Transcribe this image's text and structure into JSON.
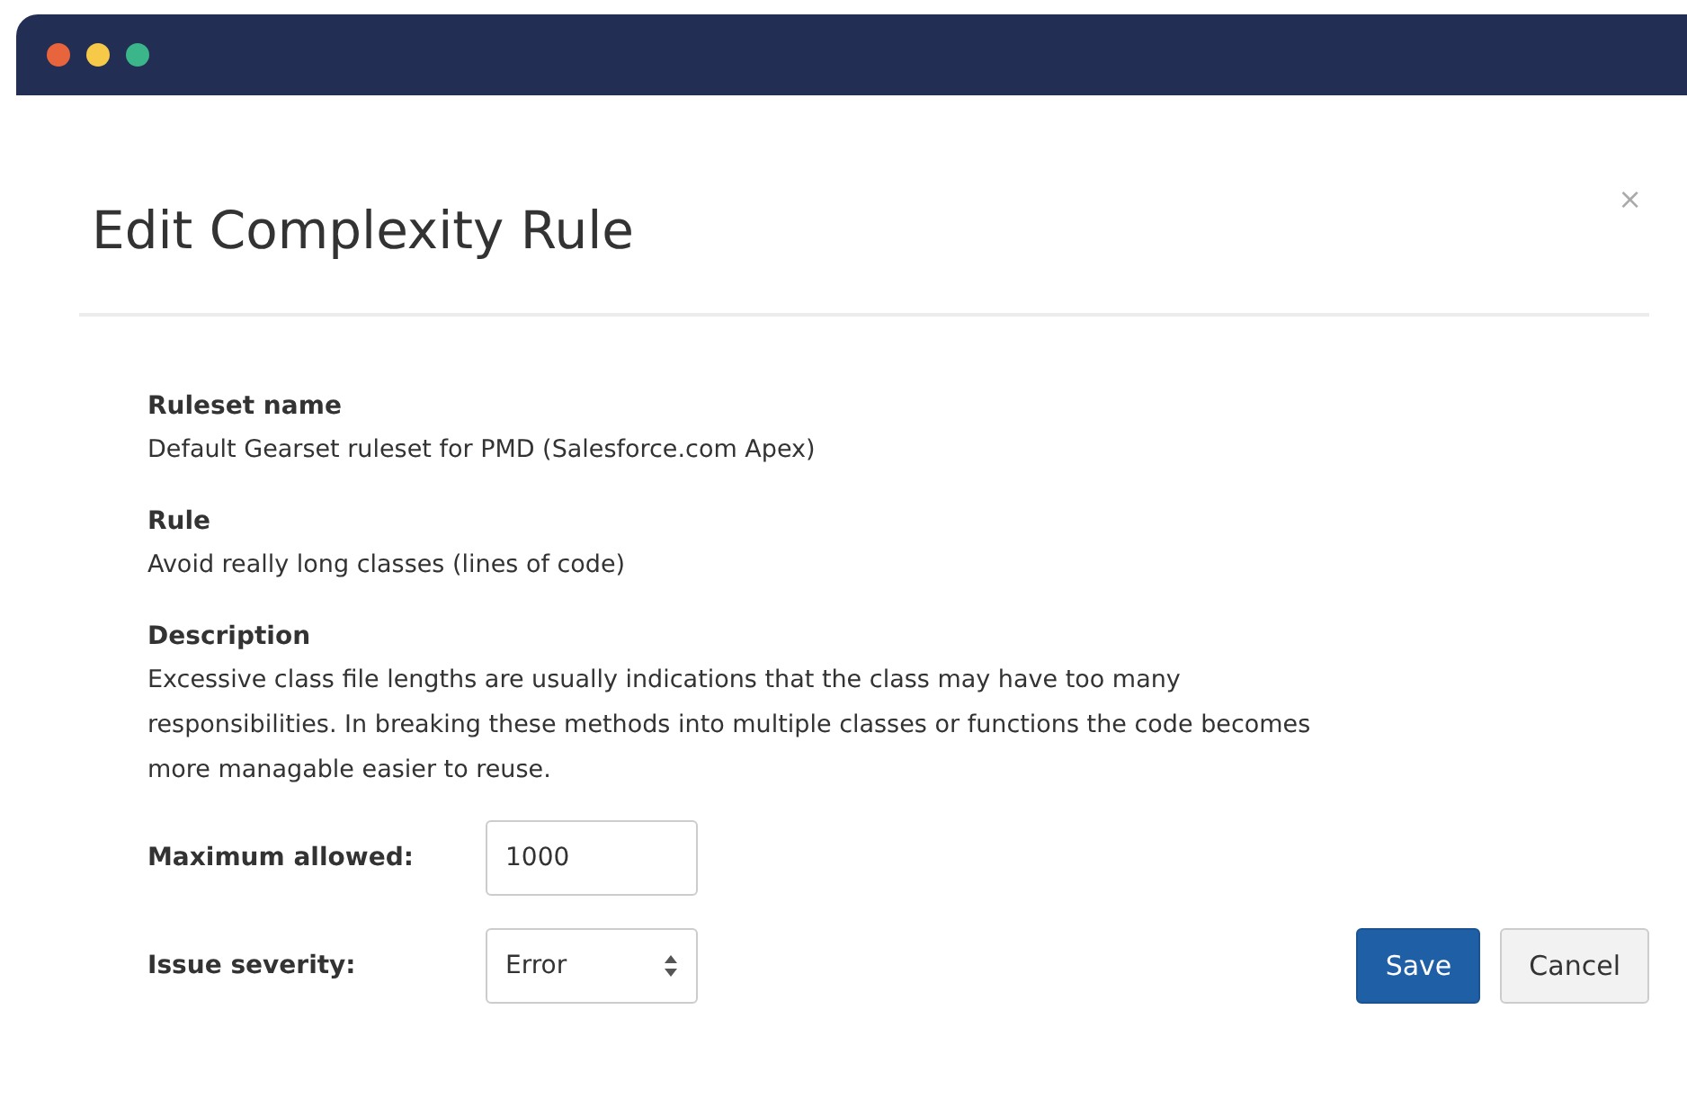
{
  "window": {
    "controls": [
      {
        "color": "#e8643c"
      },
      {
        "color": "#f7c948"
      },
      {
        "color": "#3bb58a"
      }
    ]
  },
  "dialog": {
    "title": "Edit Complexity Rule",
    "close": "×",
    "details": [
      {
        "label": "Ruleset name",
        "value": "Default Gearset ruleset for PMD (Salesforce.com Apex)"
      },
      {
        "label": "Rule",
        "value": "Avoid really long classes (lines of code)"
      },
      {
        "label": "Description",
        "value": "Excessive class file lengths are usually indications that the class may have too many responsibilities. In breaking these methods into multiple classes or functions the code becomes more managable easier to reuse."
      }
    ],
    "fields": [
      {
        "kind": "text",
        "label": "Maximum allowed:",
        "value": "1000"
      },
      {
        "kind": "select",
        "label": "Issue severity:",
        "value": "Error"
      }
    ],
    "buttons": [
      {
        "kind": "primary",
        "label": "Save"
      },
      {
        "kind": "default",
        "label": "Cancel"
      }
    ]
  }
}
